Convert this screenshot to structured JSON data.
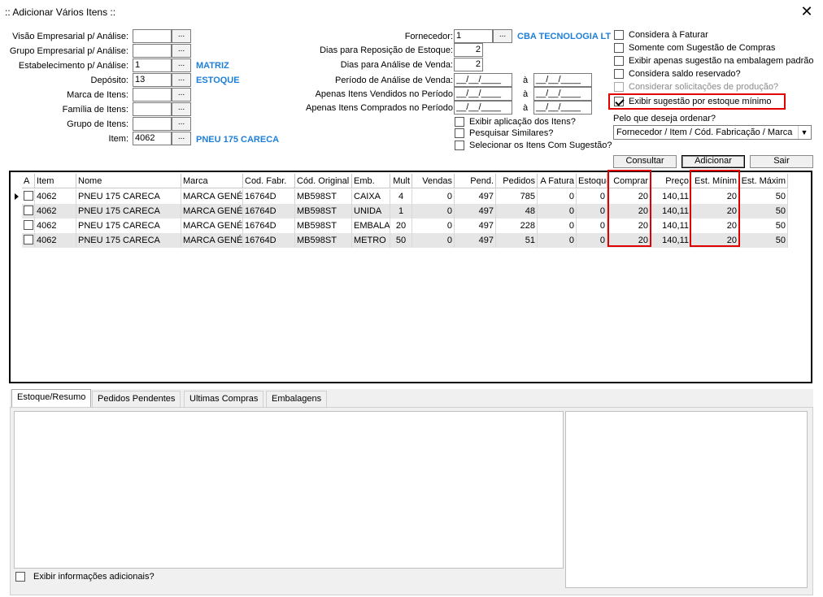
{
  "window": {
    "title": ":: Adicionar Vários Itens ::",
    "close": "✕"
  },
  "left_form": {
    "visao": {
      "label": "Visão Empresarial p/ Análise:",
      "value": "",
      "btn": "..."
    },
    "grupo_emp": {
      "label": "Grupo Empresarial p/ Análise:",
      "value": "",
      "btn": "..."
    },
    "estab": {
      "label": "Estabelecimento p/ Análise:",
      "value": "1",
      "btn": "...",
      "info": "MATRIZ"
    },
    "deposito": {
      "label": "Depósito:",
      "value": "13",
      "btn": "...",
      "info": "ESTOQUE"
    },
    "marca": {
      "label": "Marca de Itens:",
      "value": "",
      "btn": "..."
    },
    "familia": {
      "label": "Família de Itens:",
      "value": "",
      "btn": "..."
    },
    "grupo_itens": {
      "label": "Grupo de Itens:",
      "value": "",
      "btn": "..."
    },
    "item": {
      "label": "Item:",
      "value": "4062",
      "btn": "...",
      "info": "PNEU 175 CARECA"
    }
  },
  "mid_form": {
    "fornecedor": {
      "label": "Fornecedor:",
      "value": "1",
      "btn": "...",
      "info": "CBA TECNOLOGIA LT"
    },
    "dias_repos": {
      "label": "Dias para Reposição de Estoque:",
      "value": "2"
    },
    "dias_analise": {
      "label": "Dias para Análise de Venda:",
      "value": "2"
    },
    "periodo_analise": {
      "label": "Período de Análise de Venda:",
      "from": "__/__/____",
      "sep": "à",
      "to": "__/__/____"
    },
    "vendidos": {
      "label": "Apenas Itens Vendidos no  Período",
      "from": "__/__/____",
      "sep": "à",
      "to": "__/__/____"
    },
    "comprados": {
      "label": "Apenas Itens Comprados no  Período",
      "from": "__/__/____",
      "sep": "à",
      "to": "__/__/____"
    },
    "checks": [
      {
        "label": "Exibir aplicação dos Itens?",
        "checked": false
      },
      {
        "label": "Pesquisar Similares?",
        "checked": false
      },
      {
        "label": "Selecionar os Itens Com Sugestão?",
        "checked": false
      }
    ]
  },
  "right_checks": [
    {
      "label": "Considera à Faturar",
      "checked": false,
      "disabled": false
    },
    {
      "label": "Somente com Sugestão de Compras",
      "checked": false,
      "disabled": false
    },
    {
      "label": "Exibir apenas sugestão na embalagem padrão",
      "checked": false,
      "disabled": false
    },
    {
      "label": "Considera saldo reservado?",
      "checked": false,
      "disabled": false
    },
    {
      "label": "Considerar solicitações de produção?",
      "checked": false,
      "disabled": true
    },
    {
      "label": "Exibir sugestão por estoque mínimo",
      "checked": true,
      "disabled": false
    }
  ],
  "order": {
    "label": "Pelo que deseja ordenar?",
    "value": "Fornecedor / Item / Cód. Fabricação / Marca"
  },
  "buttons": {
    "consultar": "Consultar",
    "adicionar": "Adicionar",
    "sair": "Sair"
  },
  "grid": {
    "columns": [
      "A",
      "Item",
      "Nome",
      "Marca",
      "Cod. Fabr.",
      "Cód. Original",
      "Emb.",
      "Mult",
      "Vendas",
      "Pend.",
      "Pedidos",
      "A Fatura",
      "Estoque",
      "Comprar",
      "Preço",
      "Est. Mínim",
      "Est. Máxim"
    ],
    "rows": [
      [
        "",
        "4062",
        "PNEU 175 CARECA",
        "MARCA GENÉ",
        "16764D",
        "MB598ST",
        "CAIXA",
        "4",
        "0",
        "497",
        "785",
        "0",
        "0",
        "20",
        "140,11",
        "20",
        "50"
      ],
      [
        "",
        "4062",
        "PNEU 175 CARECA",
        "MARCA GENÉ",
        "16764D",
        "MB598ST",
        "UNIDA",
        "1",
        "0",
        "497",
        "48",
        "0",
        "0",
        "20",
        "140,11",
        "20",
        "50"
      ],
      [
        "",
        "4062",
        "PNEU 175 CARECA",
        "MARCA GENÉ",
        "16764D",
        "MB598ST",
        "EMBALA",
        "20",
        "0",
        "497",
        "228",
        "0",
        "0",
        "20",
        "140,11",
        "20",
        "50"
      ],
      [
        "",
        "4062",
        "PNEU 175 CARECA",
        "MARCA GENÉ",
        "16764D",
        "MB598ST",
        "METRO",
        "50",
        "0",
        "497",
        "51",
        "0",
        "0",
        "20",
        "140,11",
        "20",
        "50"
      ]
    ]
  },
  "tabs": [
    "Estoque/Resumo",
    "Pedidos Pendentes",
    "Ultimas Compras",
    "Embalagens"
  ],
  "bottom_check": {
    "label": "Exibir informações adicionais?",
    "checked": false
  },
  "colors": {
    "info": "#1e7fd8",
    "highlight": "#e00000",
    "alt_row": "#e6e6e6"
  }
}
